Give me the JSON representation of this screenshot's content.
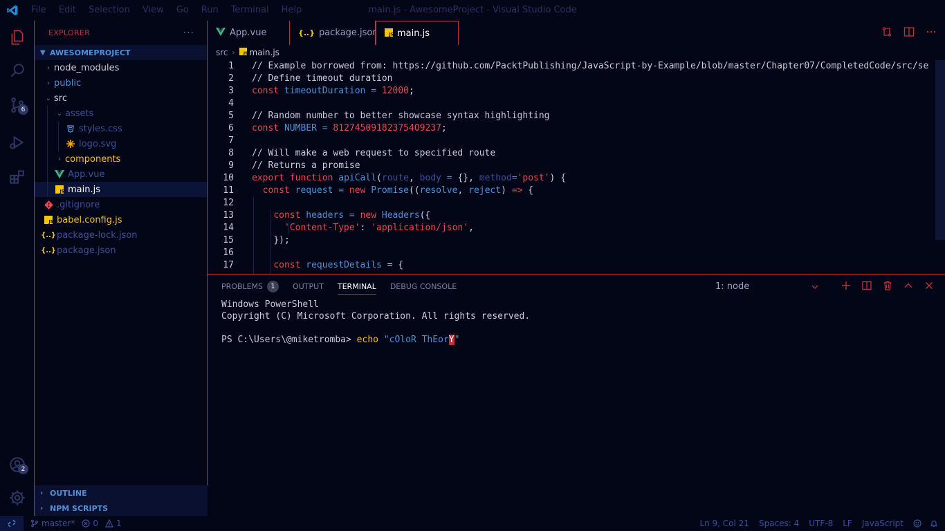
{
  "window": {
    "title": "main.js - AwesomeProject - Visual Studio Code",
    "menu": [
      "File",
      "Edit",
      "Selection",
      "View",
      "Go",
      "Run",
      "Terminal",
      "Help"
    ]
  },
  "activity": {
    "scm_badge": "6",
    "accounts_badge": "2"
  },
  "sidebar": {
    "title": "EXPLORER",
    "more": "···",
    "project": "AWESOMEPROJECT",
    "tree": [
      {
        "label": "node_modules",
        "icon": "",
        "color": "#c7cbe0"
      },
      {
        "label": "public",
        "icon": "",
        "color": "#4f8fd8"
      },
      {
        "label": "src",
        "icon": "",
        "color": "#c7cbe0"
      },
      {
        "label": "assets",
        "icon": "",
        "color": "#3b4f9a"
      },
      {
        "label": "styles.css",
        "icon": "css-icon",
        "color": "#3b4f9a"
      },
      {
        "label": "logo.svg",
        "icon": "svg-icon",
        "color": "#3b4f9a"
      },
      {
        "label": "components",
        "icon": "",
        "color": "#f1c40f"
      },
      {
        "label": "App.vue",
        "icon": "vue-icon",
        "color": "#3b4f9a"
      },
      {
        "label": "main.js",
        "icon": "js-icon",
        "color": "#ffffff"
      },
      {
        "label": ".gitignore",
        "icon": "git-icon",
        "color": "#3b4f9a"
      },
      {
        "label": "babel.config.js",
        "icon": "js-icon",
        "color": "#f1c40f"
      },
      {
        "label": "package-lock.json",
        "icon": "json-icon",
        "color": "#3b4f9a"
      },
      {
        "label": "package.json",
        "icon": "json-icon",
        "color": "#3b4f9a"
      }
    ],
    "outline": "OUTLINE",
    "npm_scripts": "NPM SCRIPTS"
  },
  "tabs": [
    {
      "label": "App.vue",
      "icon": "vue-icon"
    },
    {
      "label": "package.json",
      "icon": "json-icon"
    },
    {
      "label": "main.js",
      "icon": "js-icon"
    }
  ],
  "breadcrumb": [
    "src",
    "main.js"
  ],
  "editor": {
    "line_numbers": [
      "1",
      "2",
      "3",
      "4",
      "5",
      "6",
      "7",
      "8",
      "9",
      "10",
      "11",
      "12",
      "13",
      "14",
      "15",
      "16",
      "17"
    ],
    "l1": "// Example borrowed from: https://github.com/PacktPublishing/JavaScript-by-Example/blob/master/Chapter07/CompletedCode/src/se",
    "l2": "// Define timeout duration",
    "l3_kw": "const",
    "l3_var": "timeoutDuration",
    "l3_eq": " = ",
    "l3_num": "12000",
    "l3_end": ";",
    "l5": "// Random number to better showcase syntax highlighting",
    "l6_kw": "const",
    "l6_var": "NUMBER",
    "l6_eq": " = ",
    "l6_num": "812745091823754O9237",
    "l6_end": ";",
    "l8": "// Will make a web request to specified route",
    "l9": "// Returns a promise",
    "l10_kw1": "export",
    "l10_kw2": "function",
    "l10_fn": "apiCall",
    "l10_p1": "(",
    "l10_route": "route",
    "l10_c1": ", ",
    "l10_body": "body",
    "l10_eq": " = ",
    "l10_obj": "{}",
    "l10_c2": ", ",
    "l10_method": "method",
    "l10_eq2": "=",
    "l10_str": "'post'",
    "l10_end": ") {",
    "l11_kw": "const",
    "l11_var": "request",
    "l11_eq": " = ",
    "l11_new": "new",
    "l11_cls": "Promise",
    "l11_p": "((",
    "l11_res": "resolve",
    "l11_c": ", ",
    "l11_rej": "reject",
    "l11_arrow1": ") ",
    "l11_arrow": "=>",
    "l11_end": " {",
    "l13_kw": "const",
    "l13_var": "headers",
    "l13_eq": " = ",
    "l13_new": "new",
    "l13_cls": "Headers",
    "l13_end": "({",
    "l14_str1": "'Content-Type'",
    "l14_colon": ": ",
    "l14_str2": "'application/json'",
    "l14_end": ",",
    "l15": "});",
    "l17_kw": "const",
    "l17_var": "requestDetails",
    "l17_end": " = {"
  },
  "panel": {
    "tabs": [
      "PROBLEMS",
      "OUTPUT",
      "TERMINAL",
      "DEBUG CONSOLE"
    ],
    "problems_count": "1",
    "terminal_select": "1: node",
    "terminal": {
      "line1": "Windows PowerShell",
      "line2": "Copyright (C) Microsoft Corporation. All rights reserved.",
      "prompt": "PS C:\\Users\\@miketromba> ",
      "cmd": "echo",
      "arg": "\"cOloR ThEor",
      "cursor_char": "Y",
      "arg_end": "\""
    }
  },
  "status": {
    "branch": "master*",
    "errors": "0",
    "warnings": "1",
    "position": "Ln 9, Col 21",
    "spaces": "Spaces: 4",
    "encoding": "UTF-8",
    "eol": "LF",
    "language": "JavaScript"
  },
  "colors": {
    "background": "#030616",
    "accent_red": "#c1313a",
    "accent_blue": "#4f8fd8",
    "accent_yellow": "#f1c40f"
  }
}
